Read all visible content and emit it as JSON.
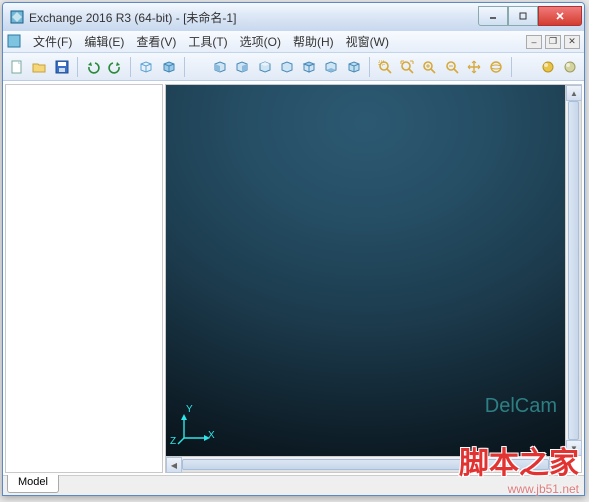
{
  "window": {
    "title": "Exchange 2016 R3 (64-bit) - [未命名-1]"
  },
  "menu": {
    "file": "文件(F)",
    "edit": "编辑(E)",
    "view": "查看(V)",
    "tools": "工具(T)",
    "options": "选项(O)",
    "help": "帮助(H)",
    "window": "视窗(W)"
  },
  "toolbar_icons": {
    "new": "new-document-icon",
    "open": "open-folder-icon",
    "save": "save-disk-icon",
    "undo": "undo-icon",
    "redo": "redo-icon",
    "wire_cube": "wireframe-cube-icon",
    "filled_cube": "filled-cube-icon",
    "iso_front": "iso-front-icon",
    "iso_back": "iso-back-icon",
    "iso_left": "iso-left-icon",
    "iso_right": "iso-right-icon",
    "iso_top": "iso-top-icon",
    "iso_bottom": "iso-bottom-icon",
    "iso_view": "iso-view-icon",
    "zoom_window": "zoom-window-icon",
    "zoom_extents": "zoom-extents-icon",
    "zoom_in": "zoom-in-icon",
    "zoom_out": "zoom-out-icon",
    "pan": "pan-hand-icon",
    "rotate": "orbit-rotate-icon",
    "sphere1": "render-sphere-icon",
    "sphere2": "toggle-sphere-icon"
  },
  "axis": {
    "x": "X",
    "y": "Y",
    "z": "Z"
  },
  "tabs": {
    "model": "Model"
  },
  "watermarks": {
    "brand_cn": "脚本之家",
    "brand_url": "www.jb51.net",
    "viewport": "DelCam"
  }
}
